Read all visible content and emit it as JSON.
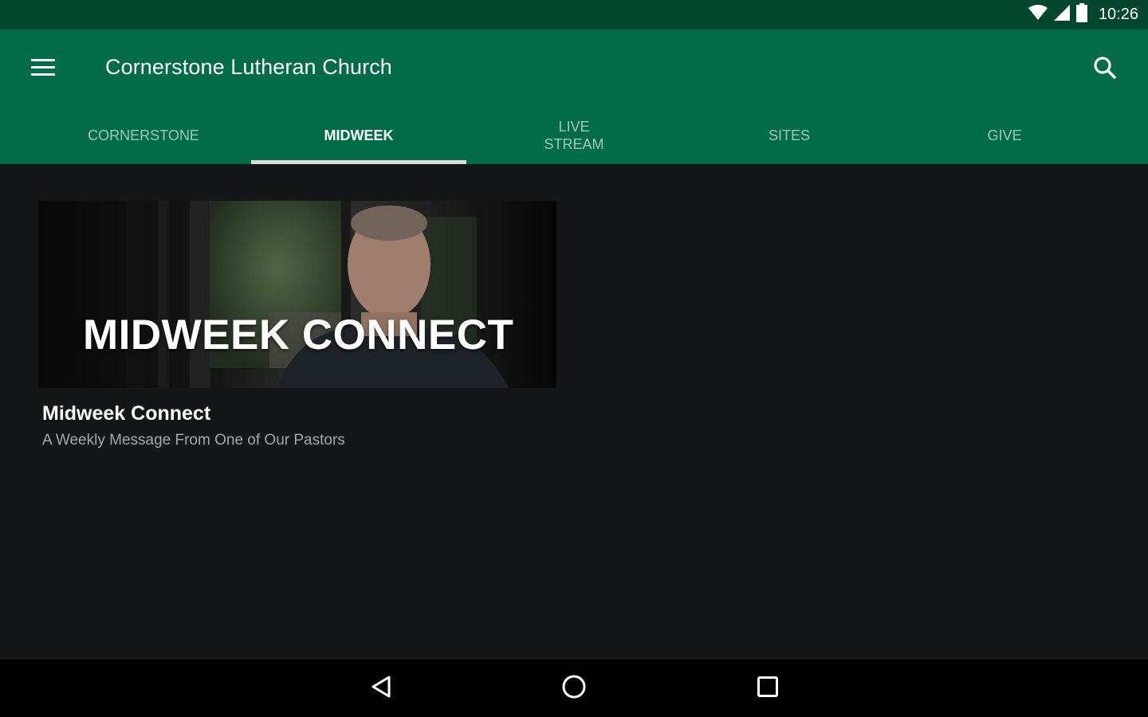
{
  "status_bar": {
    "time": "10:26",
    "icons": [
      "wifi-icon",
      "cell-signal-icon",
      "battery-icon"
    ]
  },
  "app_bar": {
    "title": "Cornerstone Lutheran Church",
    "menu_icon": "hamburger-menu-icon",
    "search_icon": "search-icon",
    "background_color": "#026c49"
  },
  "tabs": [
    {
      "label": "CORNERSTONE",
      "active": false
    },
    {
      "label": "MIDWEEK",
      "active": true
    },
    {
      "label": "LIVE\nSTREAM",
      "active": false
    },
    {
      "label": "SITES",
      "active": false
    },
    {
      "label": "GIVE",
      "active": false
    }
  ],
  "content": {
    "cards": [
      {
        "image_text": "MIDWEEK CONNECT",
        "title": "Midweek Connect",
        "subtitle": "A Weekly Message From One of Our Pastors"
      }
    ]
  },
  "nav_bar": {
    "buttons": [
      "back-icon",
      "home-icon",
      "recents-icon"
    ]
  }
}
